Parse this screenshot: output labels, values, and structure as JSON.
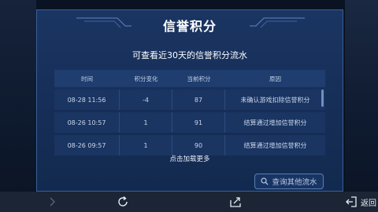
{
  "panel": {
    "title": "信誉积分",
    "subtitle": "可查看近30天的信誉积分流水"
  },
  "table": {
    "headers": [
      "时间",
      "积分变化",
      "当前积分",
      "原因"
    ],
    "rows": [
      {
        "time": "08-28  11:56",
        "change": "-4",
        "current": "87",
        "reason": "未确认游戏扣除信誉积分"
      },
      {
        "time": "08-26  10:57",
        "change": "1",
        "current": "91",
        "reason": "结算通过增加信誉积分"
      },
      {
        "time": "08-26  09:57",
        "change": "1",
        "current": "90",
        "reason": "结算通过增加信誉积分"
      }
    ]
  },
  "load_more": "点击加载更多",
  "query_button": "查询其他流水",
  "bottom_nav": {
    "back_label": "返回"
  },
  "icons": {
    "search": "search-icon",
    "forward": "chevron-right-icon",
    "refresh": "refresh-icon",
    "share": "share-icon",
    "back": "back-icon"
  },
  "colors": {
    "panel_bg": "#17305a",
    "row_bg": "#1a3562",
    "header_bg": "#1f3d6e",
    "bottom_bar": "#1c2535"
  }
}
